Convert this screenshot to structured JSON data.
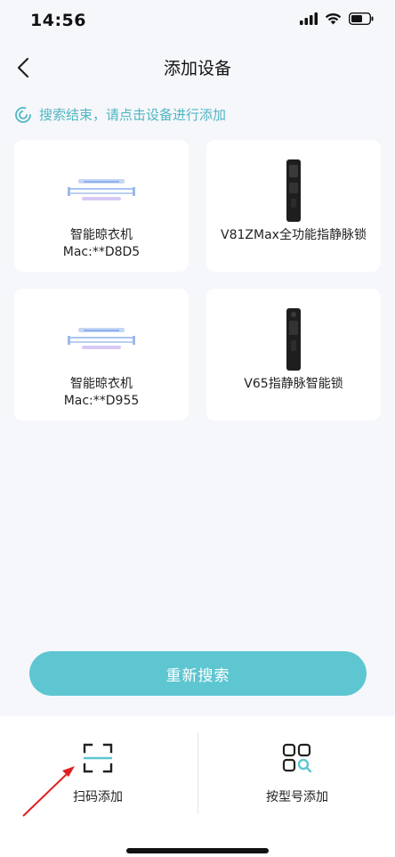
{
  "status": {
    "time": "14:56"
  },
  "nav": {
    "title": "添加设备"
  },
  "tip": {
    "text": "搜索结束，请点击设备进行添加"
  },
  "devices": [
    {
      "name": "智能晾衣机",
      "mac": "Mac:**D8D5",
      "icon": "clothes-rack"
    },
    {
      "name": "V81ZMax全功能指静脉锁",
      "mac": "",
      "icon": "smart-lock"
    },
    {
      "name": "智能晾衣机",
      "mac": "Mac:**D955",
      "icon": "clothes-rack"
    },
    {
      "name": "V65指静脉智能锁",
      "mac": "",
      "icon": "smart-lock"
    }
  ],
  "actions": {
    "rescan": "重新搜索"
  },
  "bottom": {
    "scan_label": "扫码添加",
    "model_label": "按型号添加"
  },
  "colors": {
    "accent": "#5ec6d1",
    "tip": "#4fb7c3",
    "arrow": "#e02020"
  }
}
